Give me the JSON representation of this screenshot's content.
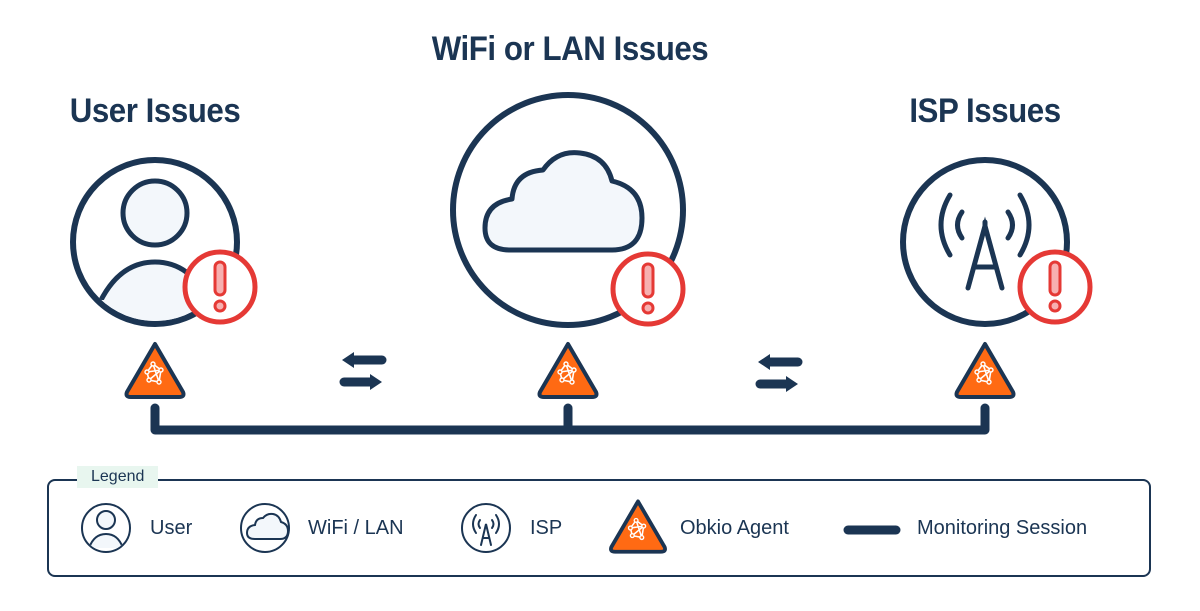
{
  "diagram": {
    "nodes": [
      {
        "id": "user",
        "title": "User Issues",
        "icon": "user-icon",
        "alert": true
      },
      {
        "id": "wifi",
        "title": "WiFi or LAN Issues",
        "icon": "cloud-icon",
        "alert": true
      },
      {
        "id": "isp",
        "title": "ISP Issues",
        "icon": "antenna-icon",
        "alert": true
      }
    ],
    "agents": [
      "Obkio Agent",
      "Obkio Agent",
      "Obkio Agent"
    ],
    "connections": [
      {
        "from": "user",
        "to": "wifi",
        "icon": "bidirectional-arrows-icon"
      },
      {
        "from": "wifi",
        "to": "isp",
        "icon": "bidirectional-arrows-icon"
      }
    ]
  },
  "legend": {
    "title": "Legend",
    "items": [
      {
        "icon": "user-icon",
        "label": "User"
      },
      {
        "icon": "cloud-icon",
        "label": "WiFi / LAN"
      },
      {
        "icon": "antenna-icon",
        "label": "ISP"
      },
      {
        "icon": "obkio-agent-icon",
        "label": "Obkio Agent"
      },
      {
        "icon": "monitoring-session-line",
        "label": "Monitoring Session"
      }
    ]
  },
  "colors": {
    "navy": "#1b3553",
    "alert_red": "#e53935",
    "alert_fill": "#f7b0b0",
    "agent_orange": "#ff6a13",
    "icon_fill": "#f3f7fb",
    "legend_badge": "#e8f6ef"
  }
}
